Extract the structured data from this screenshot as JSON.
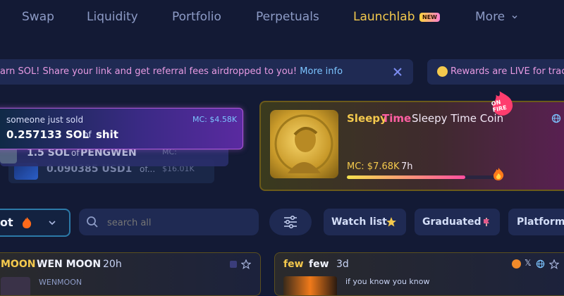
{
  "nav": {
    "items": [
      "Swap",
      "Liquidity",
      "Portfolio",
      "Perpetuals",
      "Launchlab"
    ],
    "new_badge": "NEW",
    "more": "More"
  },
  "banners": {
    "left_text": "arn SOL! Share your link and get referral fees airdropped to you!",
    "left_link": "More info",
    "right_text": "Rewards are LIVE for trac"
  },
  "feed": {
    "front": {
      "label": "someone just sold",
      "mc": "MC: $4.58K",
      "amount": "0.257133 SOL",
      "of": "of",
      "token": "shit"
    },
    "middle": {
      "amount": "1.5 SOL",
      "of": "of",
      "token": "PENGWEN",
      "mc": "MC:"
    },
    "back": {
      "amount": "0.090385 USD1",
      "of": "of...",
      "mc": "$16.01K"
    }
  },
  "featured": {
    "ticker_a": "Sleepy",
    "ticker_b": "Time",
    "name": "Sleepy Time Coin",
    "mc": "MC: $7.68K",
    "age": "7h",
    "sticker": "ON FIRE",
    "progress": 0.78
  },
  "filters": {
    "hot": "ot",
    "search_placeholder": "search all",
    "watchlist": "Watch list",
    "graduated": "Graduated",
    "platforms": "Platforms"
  },
  "cards": {
    "left": {
      "ticker": "MOON",
      "name": "WEN MOON",
      "age": "20h",
      "sub": "WENMOON"
    },
    "right": {
      "ticker": "few",
      "name": "few",
      "age": "3d",
      "desc": "if you know you know"
    }
  },
  "colors": {
    "accent_yellow": "#f4c94d",
    "accent_pink": "#ff5fa2",
    "link_blue": "#7cc4ff"
  }
}
